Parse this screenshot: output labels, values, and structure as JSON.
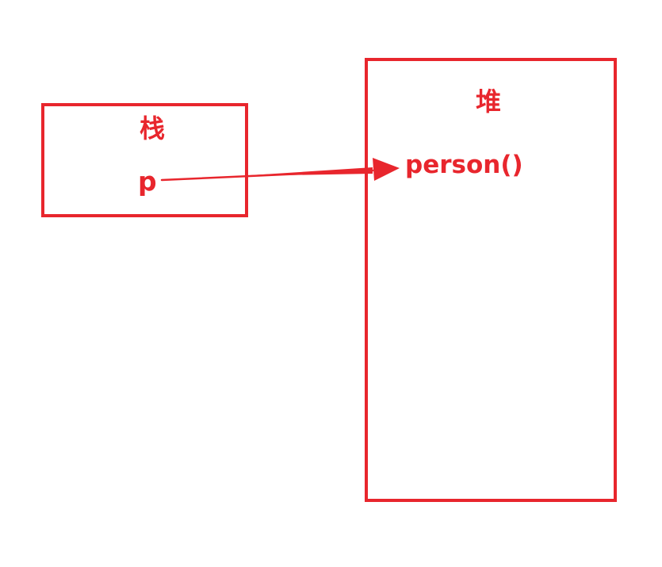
{
  "stack": {
    "title": "栈",
    "variable": "p"
  },
  "heap": {
    "title": "堆",
    "object": "person()"
  },
  "colors": {
    "accent": "#e8262d",
    "background": "#ffffff"
  }
}
